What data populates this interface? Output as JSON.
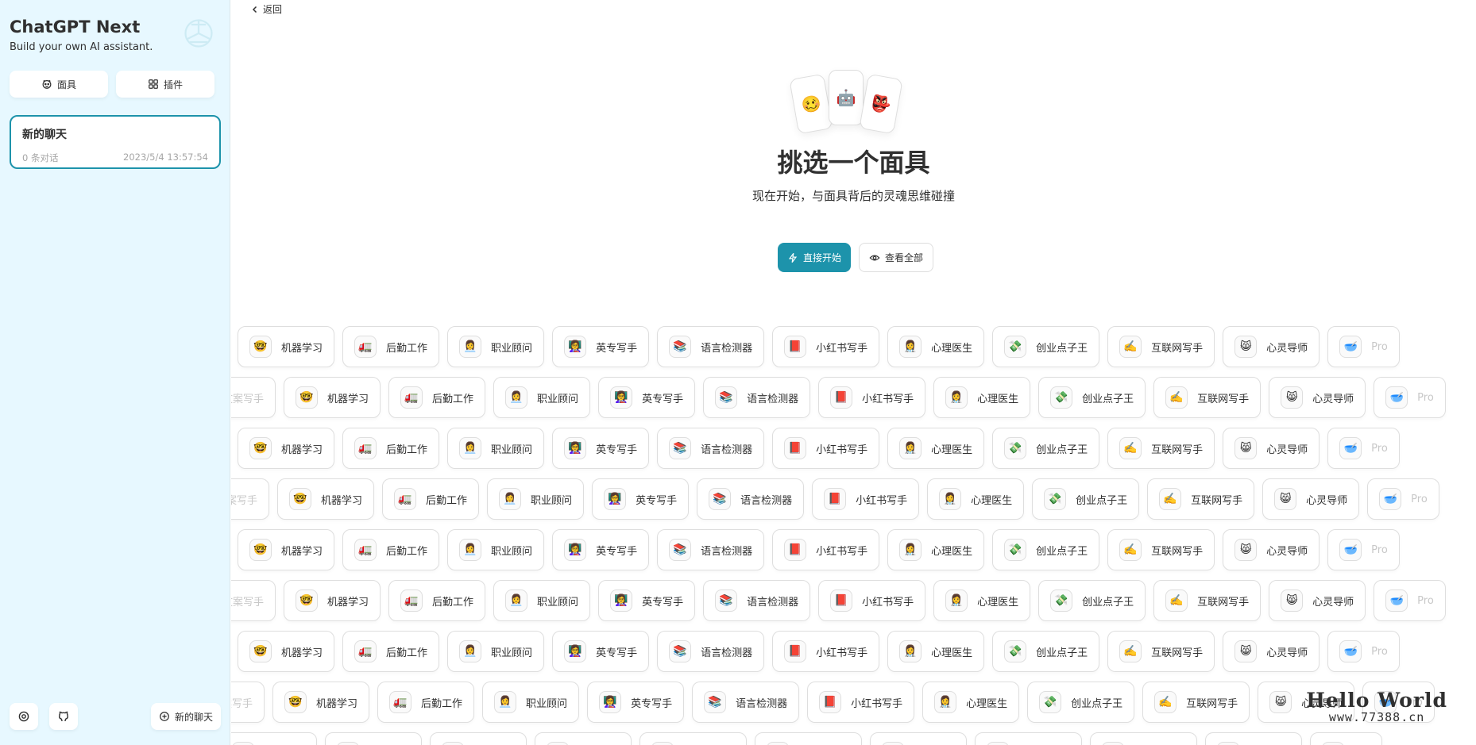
{
  "sidebar": {
    "title": "ChatGPT Next",
    "subtitle": "Build your own AI assistant.",
    "tabs": [
      {
        "label": "面具",
        "icon": "mask-icon"
      },
      {
        "label": "插件",
        "icon": "plugin-grid-icon"
      }
    ],
    "chat": {
      "title": "新的聊天",
      "count": "0 条对话",
      "time": "2023/5/4 13:57:54"
    },
    "new_chat_label": "新的聊天"
  },
  "main": {
    "back_label": "返回",
    "card_emojis": [
      "🥴",
      "🤖",
      "👺"
    ],
    "headline": "挑选一个面具",
    "subline": "现在开始，与面具背后的灵魂思维碰撞",
    "start_label": "直接开始",
    "view_all_label": "查看全部",
    "masks": [
      {
        "emoji": "🤓",
        "name": "机器学习"
      },
      {
        "emoji": "🚛",
        "name": "后勤工作"
      },
      {
        "emoji": "👩‍💼",
        "name": "职业顾问"
      },
      {
        "emoji": "👩‍🏫",
        "name": "英专写手"
      },
      {
        "emoji": "📚",
        "name": "语言检测器"
      },
      {
        "emoji": "📕",
        "name": "小红书写手"
      },
      {
        "emoji": "👩‍⚕️",
        "name": "心理医生"
      },
      {
        "emoji": "💸",
        "name": "创业点子王"
      },
      {
        "emoji": "✍️",
        "name": "互联网写手"
      },
      {
        "emoji": "😸",
        "name": "心灵导师"
      }
    ],
    "faded_left_a": "写手",
    "faded_left_b": "文案写手",
    "faded_right": "Pro",
    "faded_right_emoji": "🥣"
  },
  "watermark": {
    "line1": "Hello World",
    "line2": "www.77388.cn"
  }
}
